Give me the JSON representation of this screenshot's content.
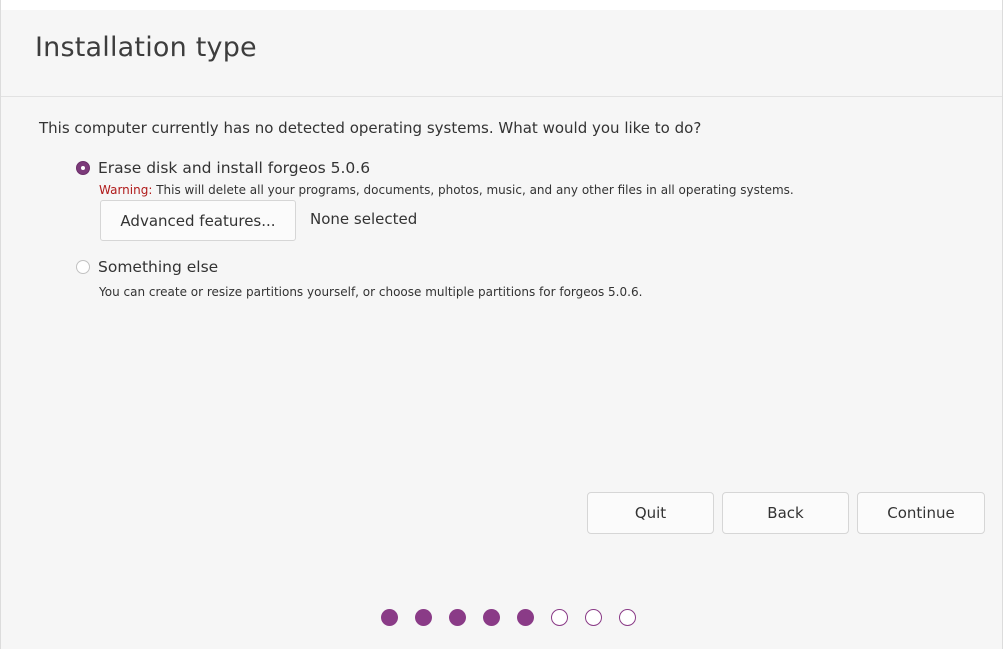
{
  "header": {
    "title": "Installation type"
  },
  "question": "This computer currently has no detected operating systems. What would you like to do?",
  "options": [
    {
      "label": "Erase disk and install forgeos 5.0.6",
      "selected": true,
      "warning_label": "Warning:",
      "description": "This will delete all your programs, documents, photos, music, and any other files in all operating systems."
    },
    {
      "label": "Something else",
      "selected": false,
      "description": "You can create or resize partitions yourself, or choose multiple partitions for forgeos 5.0.6."
    }
  ],
  "advanced": {
    "button_label": "Advanced features...",
    "status": "None selected"
  },
  "buttons": {
    "quit": "Quit",
    "back": "Back",
    "continue": "Continue"
  },
  "progress": {
    "completed_steps": 5,
    "total_steps": 8
  },
  "colors": {
    "accent": "#8a3b87",
    "warning": "#b01a1a"
  }
}
